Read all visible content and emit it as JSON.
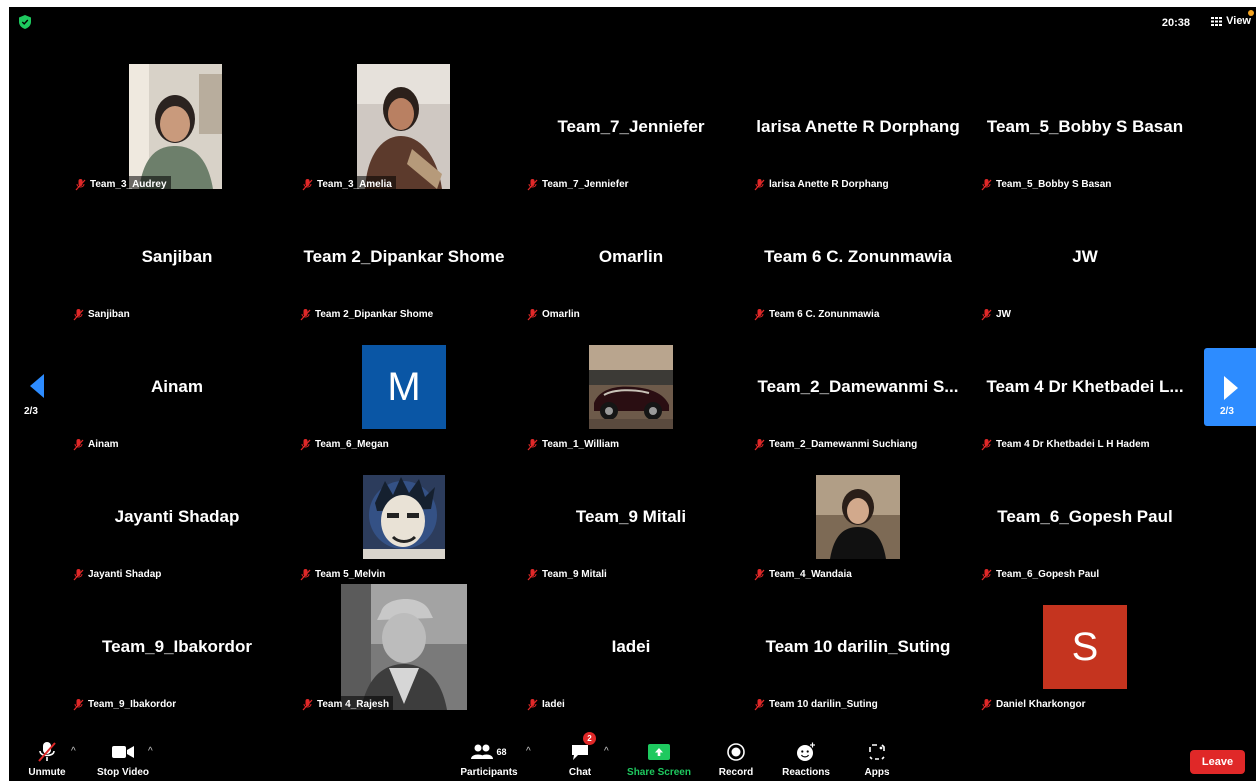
{
  "header": {
    "time": "20:38",
    "view_label": "View"
  },
  "colors": {
    "accent": "#2d8cff",
    "leave": "#e02828",
    "share": "#1ec95f",
    "mute": "#e02828"
  },
  "pager": {
    "left_label": "2/3",
    "right_label": "2/3"
  },
  "participants": [
    {
      "big_name": "",
      "label": "Team_3_Audrey",
      "media": "photo"
    },
    {
      "big_name": "",
      "label": "Team_3_Amelia",
      "media": "photo"
    },
    {
      "big_name": "Team_7_Jenniefer",
      "label": "Team_7_Jenniefer",
      "media": "none"
    },
    {
      "big_name": "larisa Anette R Dorphang",
      "label": "larisa Anette R Dorphang",
      "media": "none"
    },
    {
      "big_name": "Team_5_Bobby S Basan",
      "label": "Team_5_Bobby S Basan",
      "media": "none"
    },
    {
      "big_name": "Sanjiban",
      "label": "Sanjiban",
      "media": "none"
    },
    {
      "big_name": "Team 2_Dipankar Shome",
      "label": "Team 2_Dipankar Shome",
      "media": "none"
    },
    {
      "big_name": "Omarlin",
      "label": "Omarlin",
      "media": "none"
    },
    {
      "big_name": "Team 6 C. Zonunmawia",
      "label": "Team 6 C. Zonunmawia",
      "media": "none"
    },
    {
      "big_name": "JW",
      "label": "JW",
      "media": "none"
    },
    {
      "big_name": "Ainam",
      "label": "Ainam",
      "media": "none"
    },
    {
      "big_name": "",
      "label": "Team_6_Megan",
      "media": "letter",
      "letter": "M",
      "color": "#0a56a5"
    },
    {
      "big_name": "",
      "label": "Team_1_William",
      "media": "photo"
    },
    {
      "big_name": "Team_2_Damewanmi S...",
      "label": "Team_2_Damewanmi Suchiang",
      "media": "none"
    },
    {
      "big_name": "Team 4 Dr Khetbadei L...",
      "label": "Team 4 Dr Khetbadei L H Hadem",
      "media": "none"
    },
    {
      "big_name": "Jayanti Shadap",
      "label": "Jayanti Shadap",
      "media": "none"
    },
    {
      "big_name": "",
      "label": "Team 5_Melvin",
      "media": "photo"
    },
    {
      "big_name": "Team_9 Mitali",
      "label": "Team_9 Mitali",
      "media": "none"
    },
    {
      "big_name": "",
      "label": "Team_4_Wandaia",
      "media": "photo"
    },
    {
      "big_name": "Team_6_Gopesh Paul",
      "label": "Team_6_Gopesh Paul",
      "media": "none"
    },
    {
      "big_name": "Team_9_Ibakordor",
      "label": "Team_9_Ibakordor",
      "media": "none"
    },
    {
      "big_name": "",
      "label": "Team 4_Rajesh",
      "media": "photo"
    },
    {
      "big_name": "Iadei",
      "label": "Iadei",
      "media": "none"
    },
    {
      "big_name": "Team 10 darilin_Suting",
      "label": "Team 10 darilin_Suting",
      "media": "none"
    },
    {
      "big_name": "",
      "label": "Daniel Kharkongor",
      "media": "letter",
      "letter": "S",
      "color": "#c5341f"
    }
  ],
  "toolbar": {
    "unmute": "Unmute",
    "stop_video": "Stop Video",
    "participants": "Participants",
    "participants_count": "68",
    "chat": "Chat",
    "chat_badge": "2",
    "share_screen": "Share Screen",
    "record": "Record",
    "reactions": "Reactions",
    "apps": "Apps",
    "leave": "Leave"
  }
}
